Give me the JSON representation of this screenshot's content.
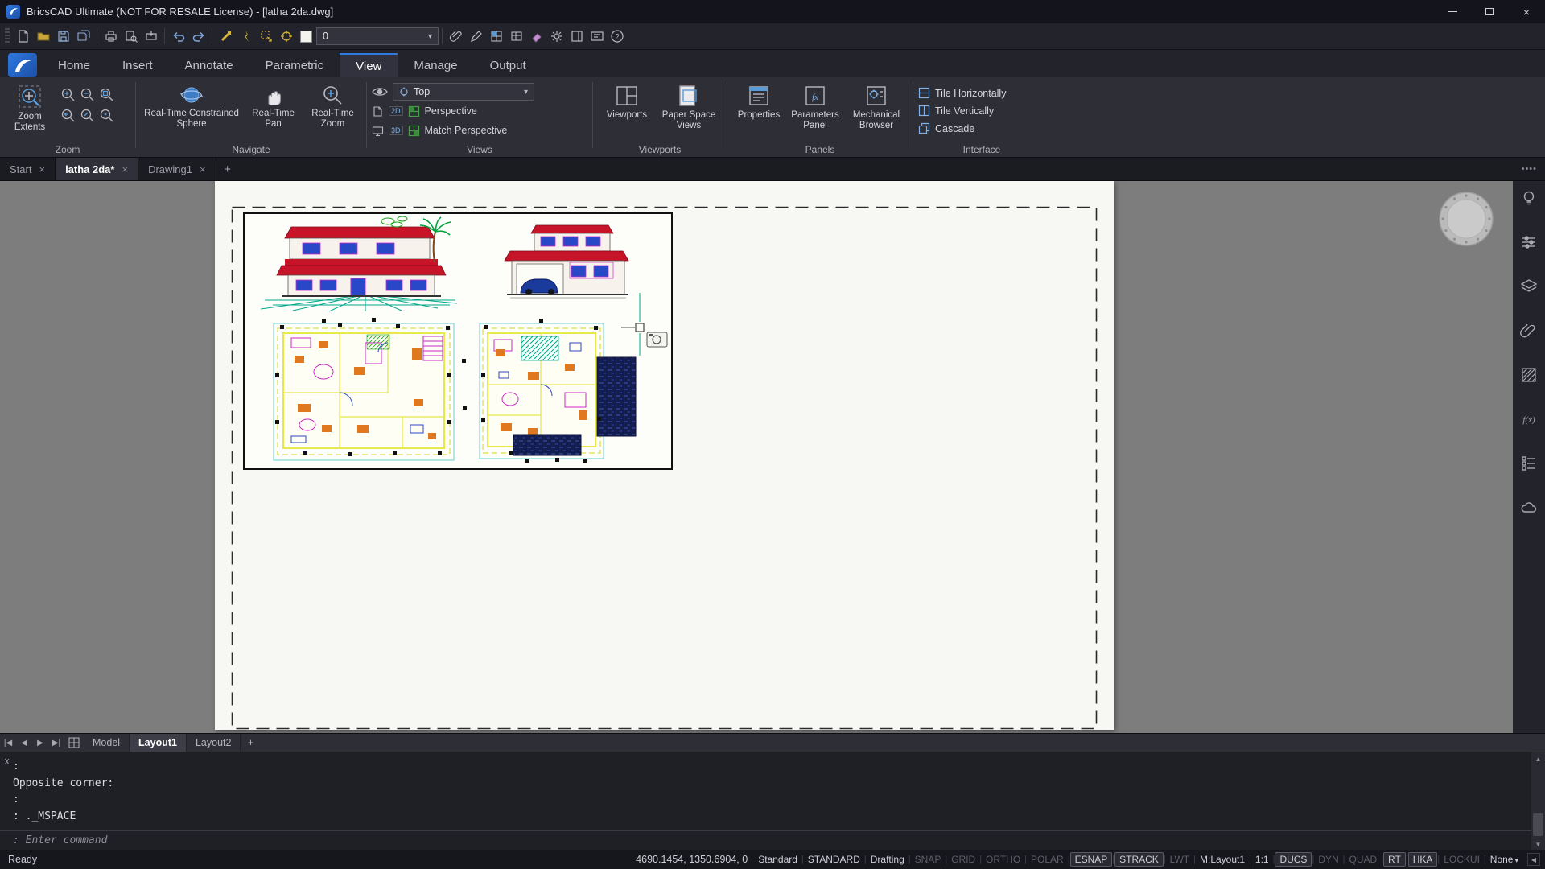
{
  "window": {
    "title": "BricsCAD Ultimate (NOT FOR RESALE License) - [latha 2da.dwg]"
  },
  "qat": {
    "layer_value": "0"
  },
  "ribbon": {
    "tabs": [
      {
        "label": "Home",
        "active": false
      },
      {
        "label": "Insert",
        "active": false
      },
      {
        "label": "Annotate",
        "active": false
      },
      {
        "label": "Parametric",
        "active": false
      },
      {
        "label": "View",
        "active": true
      },
      {
        "label": "Manage",
        "active": false
      },
      {
        "label": "Output",
        "active": false
      }
    ],
    "groups": {
      "zoom": {
        "label": "Zoom",
        "zoom_extents": "Zoom Extents"
      },
      "navigate": {
        "label": "Navigate",
        "constrained_sphere": "Real-Time Constrained Sphere",
        "pan": "Real-Time Pan",
        "rt_zoom": "Real-Time Zoom"
      },
      "views": {
        "label": "Views",
        "selected_view": "Top",
        "perspective": "Perspective",
        "match_perspective": "Match Perspective",
        "badge_2d": "2D",
        "badge_3d": "3D"
      },
      "viewports": {
        "label": "Viewports",
        "viewports": "Viewports",
        "paper_space_views": "Paper Space Views"
      },
      "panels": {
        "label": "Panels",
        "properties": "Properties",
        "parameters_panel": "Parameters Panel",
        "mechanical_browser": "Mechanical Browser"
      },
      "interface": {
        "label": "Interface",
        "tile_h": "Tile Horizontally",
        "tile_v": "Tile Vertically",
        "cascade": "Cascade"
      }
    }
  },
  "document_tabs": {
    "tabs": [
      {
        "label": "Start",
        "active": false
      },
      {
        "label": "latha 2da*",
        "active": true
      },
      {
        "label": "Drawing1",
        "active": false
      }
    ],
    "add": "+",
    "overflow_dots": "••••"
  },
  "layout_bar": {
    "nav": {
      "first": "|◀",
      "prev": "◀",
      "next": "▶",
      "last": "▶|"
    },
    "tabs": [
      {
        "label": "Model",
        "active": false
      },
      {
        "label": "Layout1",
        "active": true
      },
      {
        "label": "Layout2",
        "active": false
      }
    ],
    "add": "+"
  },
  "command_panel": {
    "close": "x",
    "lines": [
      ":",
      "Opposite corner:",
      ":",
      ": ._MSPACE"
    ],
    "prompt": ": Enter command"
  },
  "status_bar": {
    "ready": "Ready",
    "coordinates": "4690.1454, 1350.6904, 0",
    "fields": [
      {
        "label": "Standard",
        "state": "on"
      },
      {
        "label": "STANDARD",
        "state": "on"
      },
      {
        "label": "Drafting",
        "state": "on"
      },
      {
        "label": "SNAP",
        "state": "off"
      },
      {
        "label": "GRID",
        "state": "off"
      },
      {
        "label": "ORTHO",
        "state": "off"
      },
      {
        "label": "POLAR",
        "state": "off"
      },
      {
        "label": "ESNAP",
        "state": "boxed"
      },
      {
        "label": "STRACK",
        "state": "boxed"
      },
      {
        "label": "LWT",
        "state": "off"
      },
      {
        "label": "M:Layout1",
        "state": "on"
      },
      {
        "label": "1:1",
        "state": "on"
      },
      {
        "label": "DUCS",
        "state": "boxed"
      },
      {
        "label": "DYN",
        "state": "off"
      },
      {
        "label": "QUAD",
        "state": "off"
      },
      {
        "label": "RT",
        "state": "boxed"
      },
      {
        "label": "HKA",
        "state": "boxed"
      },
      {
        "label": "LOCKUI",
        "state": "off"
      },
      {
        "label": "None",
        "state": "on"
      }
    ]
  },
  "glyphs": {
    "close": "×",
    "caret": "▾",
    "up": "▲",
    "down": "▼",
    "collapse": "◀"
  },
  "colors": {
    "accent_blue": "#2f7ae0",
    "roof_red": "#c81428",
    "wall_yellow": "#e8e84a",
    "cad_blue": "#2948c8",
    "cad_magenta": "#c828c8",
    "cad_teal": "#00a88a",
    "cad_orange": "#e07820",
    "paper": "#f7f7f4",
    "canvas_gray": "#7d7d7d"
  }
}
